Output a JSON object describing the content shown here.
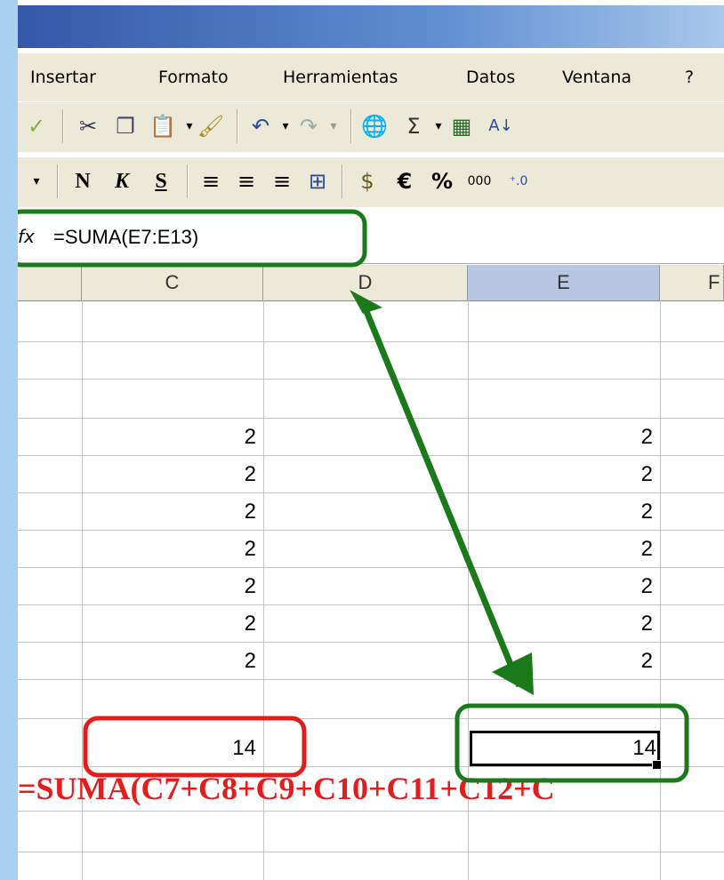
{
  "menu": [
    {
      "id": "insertar",
      "label": "Insertar"
    },
    {
      "id": "formato",
      "label": "Formato"
    },
    {
      "id": "herramientas",
      "label": "Herramientas"
    },
    {
      "id": "datos",
      "label": "Datos"
    },
    {
      "id": "ventana",
      "label": "Ventana"
    },
    {
      "id": "ayuda",
      "label": "?"
    }
  ],
  "formatting": {
    "bold": "N",
    "italic": "K",
    "underline": "S",
    "currency": "€",
    "percent": "%",
    "thousands": "000"
  },
  "formula_bar": {
    "fx": "fx",
    "formula": "=SUMA(E7:E13)"
  },
  "columns": {
    "c": "C",
    "d": "D",
    "e": "E",
    "f": "F"
  },
  "cells": {
    "c_values": [
      "2",
      "2",
      "2",
      "2",
      "2",
      "2",
      "2"
    ],
    "e_values": [
      "2",
      "2",
      "2",
      "2",
      "2",
      "2",
      "2"
    ],
    "c_total": "14",
    "e_total": "14"
  },
  "annotation": "=SUMA(C7+C8+C9+C10+C11+C12+C",
  "colors": {
    "green": "#1a7a1a",
    "red": "#e41c1c",
    "selected_header": "#b7c6e3"
  }
}
